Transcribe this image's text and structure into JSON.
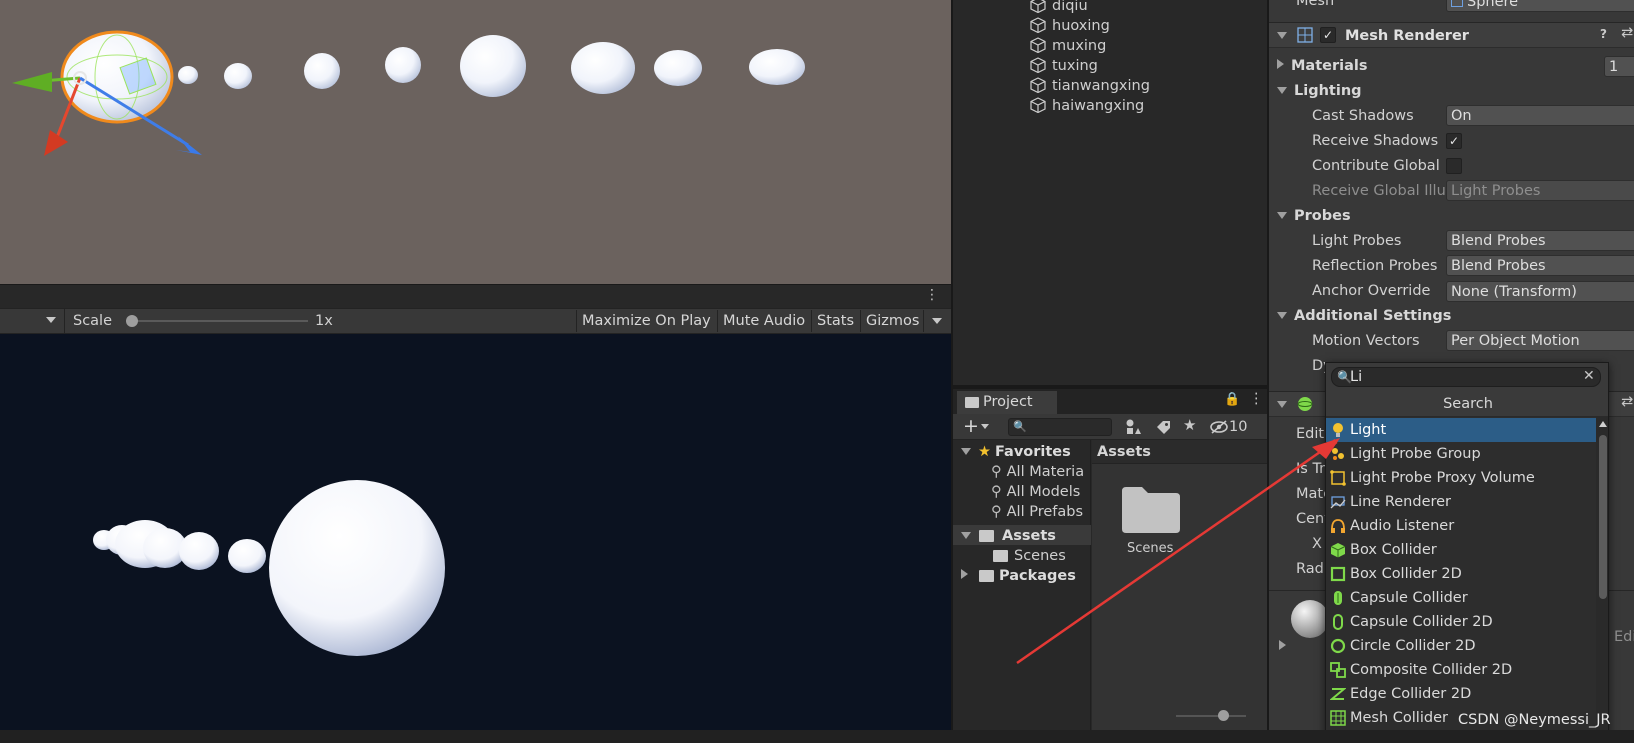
{
  "game_toolbar": {
    "scale_label": "Scale",
    "scale_value": "1x",
    "scale_slider_level": 0.02,
    "maximize_on_play": "Maximize On Play",
    "mute_audio": "Mute Audio",
    "stats": "Stats",
    "gizmos": "Gizmos"
  },
  "hierarchy": {
    "items": [
      "diqiu",
      "huoxing",
      "muxing",
      "tuxing",
      "tianwangxing",
      "haiwangxing"
    ]
  },
  "project": {
    "tab_label": "Project",
    "hidden_count": "10",
    "favorites_label": "Favorites",
    "favorites": [
      "All Materia",
      "All Models",
      "All Prefabs"
    ],
    "assets_label": "Assets",
    "scenes_label": "Scenes",
    "packages_label": "Packages",
    "assets_header": "Assets",
    "folder_label": "Scenes"
  },
  "inspector": {
    "mesh_label": "Mesh",
    "mesh_value": "Sphere",
    "mesh_renderer_title": "Mesh Renderer",
    "materials_label": "Materials",
    "materials_count": "1",
    "lighting_label": "Lighting",
    "cast_shadows_label": "Cast Shadows",
    "cast_shadows_value": "On",
    "receive_shadows_label": "Receive Shadows",
    "contribute_global_label": "Contribute Global",
    "receive_global_label": "Receive Global Illu",
    "receive_global_value": "Light Probes",
    "probes_label": "Probes",
    "light_probes_label": "Light Probes",
    "light_probes_value": "Blend Probes",
    "reflection_probes_label": "Reflection Probes",
    "reflection_probes_value": "Blend Probes",
    "anchor_override_label": "Anchor Override",
    "anchor_override_value": "None (Transform)",
    "additional_settings_label": "Additional Settings",
    "motion_vectors_label": "Motion Vectors",
    "motion_vectors_value": "Per Object Motion",
    "dynamic_occlusion_label": "Dy",
    "edit_label": "Edit",
    "is_trigger_label": "Is Tr",
    "material_label": "Mate",
    "center_label": "Cent",
    "x_label": "X",
    "radius_label": "Radi",
    "edit_short": "Edi"
  },
  "dropdown": {
    "search_value": "Li",
    "title": "Search",
    "items": [
      {
        "label": "Light",
        "icon": "light-bulb-icon",
        "selected": true
      },
      {
        "label": "Light Probe Group",
        "icon": "light-probe-group-icon",
        "selected": false
      },
      {
        "label": "Light Probe Proxy Volume",
        "icon": "light-probe-proxy-volume-icon",
        "selected": false
      },
      {
        "label": "Line Renderer",
        "icon": "line-renderer-icon",
        "selected": false
      },
      {
        "label": "Audio Listener",
        "icon": "headphones-icon",
        "selected": false
      },
      {
        "label": "Box Collider",
        "icon": "box-collider-icon",
        "selected": false
      },
      {
        "label": "Box Collider 2D",
        "icon": "box-collider-2d-icon",
        "selected": false
      },
      {
        "label": "Capsule Collider",
        "icon": "capsule-collider-icon",
        "selected": false
      },
      {
        "label": "Capsule Collider 2D",
        "icon": "capsule-collider-2d-icon",
        "selected": false
      },
      {
        "label": "Circle Collider 2D",
        "icon": "circle-collider-2d-icon",
        "selected": false
      },
      {
        "label": "Composite Collider 2D",
        "icon": "composite-collider-2d-icon",
        "selected": false
      },
      {
        "label": "Edge Collider 2D",
        "icon": "edge-collider-2d-icon",
        "selected": false
      },
      {
        "label": "Mesh Collider",
        "icon": "mesh-collider-icon",
        "selected": false
      }
    ]
  },
  "colors": {
    "scene_bg": "#6b625e",
    "game_bg": "#0b1220",
    "selection": "#2c5d87",
    "annotation_arrow": "#e53935",
    "collider_green": "#9be45a"
  },
  "watermark": "CSDN @Neymessi_JR"
}
